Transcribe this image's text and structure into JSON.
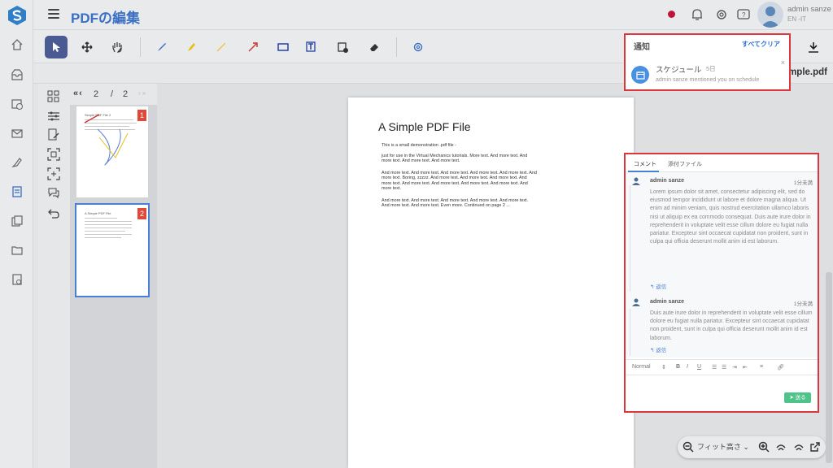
{
  "app": {
    "title": "PDFの編集",
    "user_name": "admin sanze",
    "user_lang": "EN -IT"
  },
  "sidebar": {
    "items": [
      {
        "icon": "home-icon"
      },
      {
        "icon": "inbox-icon"
      },
      {
        "icon": "calendar-clock-icon"
      },
      {
        "icon": "mail-icon"
      },
      {
        "icon": "sign-icon"
      },
      {
        "icon": "pdf-edit-icon",
        "active": true
      },
      {
        "icon": "documents-icon"
      },
      {
        "icon": "folder-icon"
      },
      {
        "icon": "archive-icon"
      }
    ]
  },
  "toolbar": {
    "tools": [
      "select-tool",
      "move-tool",
      "pan-tool",
      "pen-tool",
      "highlighter-tool",
      "line-tool",
      "arrow-tool",
      "rectangle-tool",
      "text-tool",
      "stamp-tool",
      "eraser-tool",
      "settings-tool"
    ],
    "accent": "#4a5b94"
  },
  "file": {
    "name": "mple.pdf"
  },
  "pager": {
    "current": "2",
    "slash": "/",
    "total": "2"
  },
  "thumbnails": [
    {
      "badge": "1",
      "title": "Simple PDF File 2"
    },
    {
      "badge": "2",
      "title": "A Simple PDF File"
    }
  ],
  "document": {
    "title": "A Simple PDF File",
    "paragraphs": [
      "This is a small demonstration .pdf file -",
      "just for use in the Virtual Mechanics tutorials. More text. And more text. And more text. And more text. And more text.",
      "And more text. And more text. And more text. And more text. And more text. And more text. Boring, zzzzz. And more text. And more text. And more text. And more text. And more text. And more text. And more text. And more text. And more text.",
      "And more text. And more text. And more text. And more text. And more text. And more text. And more text. Even more. Continued on page 2 ..."
    ]
  },
  "notifications": {
    "title": "通知",
    "clear_all": "すべてクリア",
    "close": "×",
    "items": [
      {
        "title": "スケジュール",
        "ago": "5日",
        "message": "admin sanze mentioned you on schedule"
      }
    ]
  },
  "comments": {
    "tabs": [
      "コメント",
      "添付ファイル"
    ],
    "threads": [
      {
        "user": "admin sanze",
        "ago": "1分未満",
        "body": "Lorem ipsum dolor sit amet, consectetur adipiscing elit, sed do eiusmod tempor incididunt ut labore et dolore magna aliqua. Ut enim ad minim veniam, quis nostrud exercitation ullamco laboris nisi ut aliquip ex ea commodo consequat. Duis aute irure dolor in reprehenderit in voluptate velit esse cillum dolore eu fugiat nulla pariatur. Excepteur sint occaecat cupidatat non proident, sunt in culpa qui officia deserunt mollit anim id est laborum.",
        "reply": "返信"
      },
      {
        "user": "admin sanze",
        "ago": "1分未満",
        "body": "Duis aute irure dolor in reprehenderit in voluptate velit esse cillum dolore eu fugiat nulla pariatur. Excepteur sint occaecat cupidatat non proident, sunt in culpa qui officia deserunt mollit anim id est laborum.",
        "reply": "返信"
      }
    ],
    "editor": {
      "format": "Normal",
      "arrow": "⇕",
      "bold": "B",
      "italic": "I",
      "underline": "U",
      "send": "送る"
    }
  },
  "zoom": {
    "value": "フィット高さ"
  },
  "colors": {
    "title_blue": "#3a6fc4",
    "highlight_red": "#d9363e",
    "send_green": "#4fc38a"
  }
}
